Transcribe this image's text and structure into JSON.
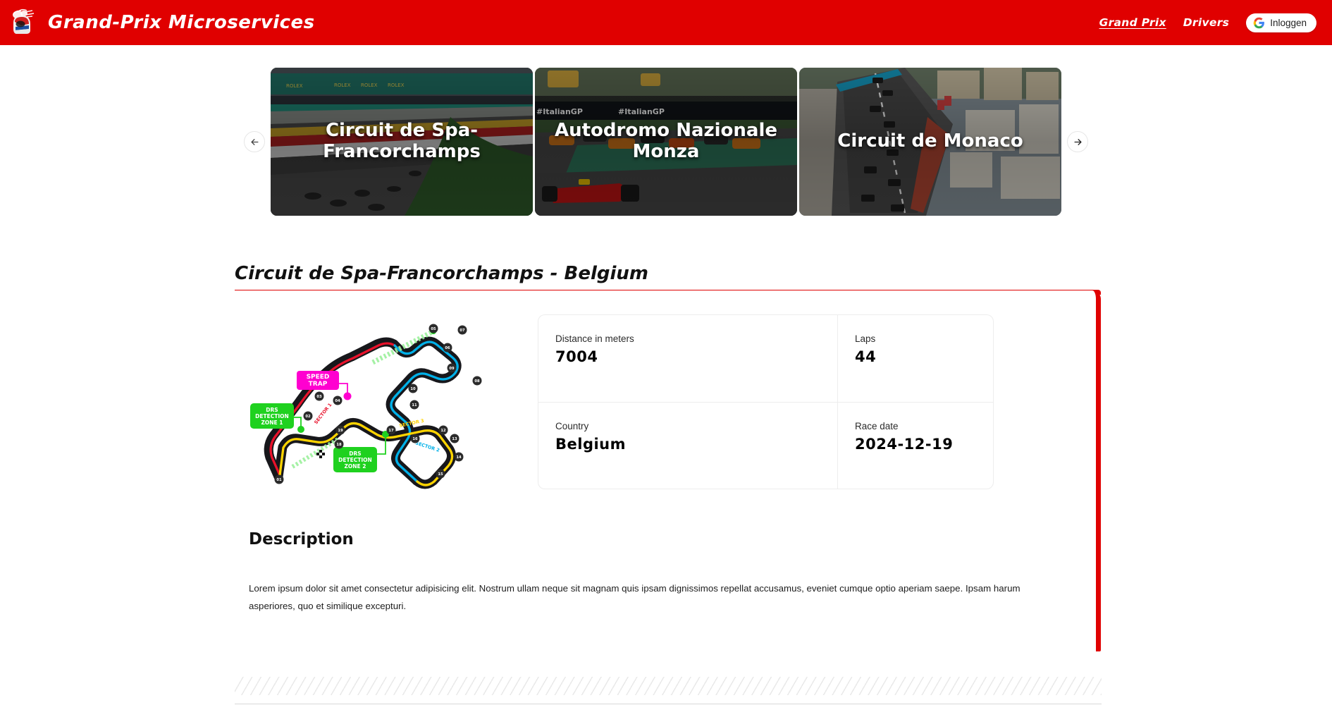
{
  "header": {
    "brand_title": "Grand-Prix Microservices",
    "logo_icon": "racing-helmet-icon",
    "nav": [
      {
        "label": "Grand Prix",
        "active": true
      },
      {
        "label": "Drivers",
        "active": false
      }
    ],
    "login_button": {
      "label": "Inloggen",
      "icon": "google-g-icon"
    },
    "background_color": "#e00000"
  },
  "carousel": {
    "prev_icon": "arrow-left-icon",
    "next_icon": "arrow-right-icon",
    "cards": [
      {
        "title": "Circuit de Spa-Francorchamps",
        "image": "spa-grandstand-track-photo"
      },
      {
        "title": "Autodromo Nazionale Monza",
        "image": "monza-start-pack-photo"
      },
      {
        "title": "Circuit de Monaco",
        "image": "monaco-street-circuit-photo"
      }
    ]
  },
  "section": {
    "title": "Circuit de Spa-Francorchamps - Belgium",
    "accent_color": "#e00000"
  },
  "track_map": {
    "name": "spa-francorchamps-track-map",
    "speed_trap_label": "SPEED TRAP",
    "drs_zone_1_label": "DRS DETECTION ZONE 1",
    "drs_zone_2_label": "DRS DETECTION ZONE 2",
    "sector_1_label": "SECTOR 1",
    "sector_2_label": "SECTOR 2",
    "sector_3_label": "SECTOR 3",
    "sector_1_color": "#e8122b",
    "sector_2_color": "#00b0e8",
    "sector_3_color": "#ffd400",
    "drs_color": "#1fd11f",
    "speed_trap_color": "#ff00d0",
    "corners": [
      "01",
      "02",
      "03",
      "04",
      "05",
      "06",
      "07",
      "08",
      "09",
      "10",
      "11",
      "12",
      "13",
      "14",
      "15",
      "16",
      "17",
      "18",
      "19"
    ]
  },
  "stats": [
    {
      "label": "Distance in meters",
      "value": "7004"
    },
    {
      "label": "Laps",
      "value": "44"
    },
    {
      "label": "Country",
      "value": "Belgium"
    },
    {
      "label": "Race date",
      "value": "2024-12-19"
    }
  ],
  "description": {
    "title": "Description",
    "body": "Lorem ipsum dolor sit amet consectetur adipisicing elit. Nostrum ullam neque sit magnam quis ipsam dignissimos repellat accusamus, eveniet cumque optio aperiam saepe. Ipsam harum asperiores, quo et similique excepturi."
  }
}
